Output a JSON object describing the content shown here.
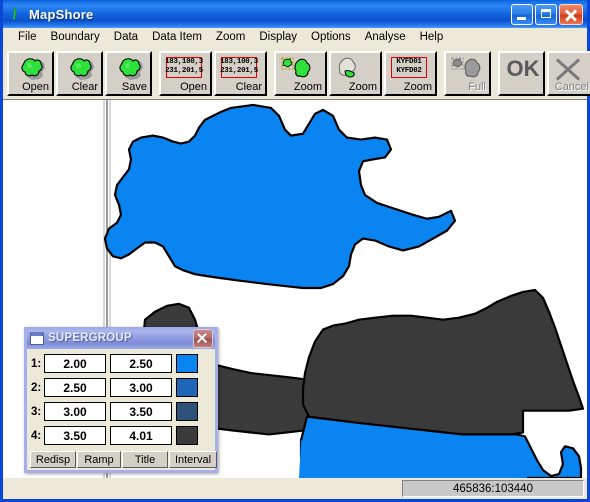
{
  "window": {
    "title": "MapShore",
    "icon": "mapshore-logo-icon",
    "caption": {
      "minimize": "minimize-icon",
      "maximize": "maximize-icon",
      "close": "close-icon"
    }
  },
  "menubar": {
    "items": [
      {
        "label": "File"
      },
      {
        "label": "Boundary"
      },
      {
        "label": "Data"
      },
      {
        "label": "Data Item"
      },
      {
        "label": "Zoom"
      },
      {
        "label": "Display"
      },
      {
        "label": "Options"
      },
      {
        "label": "Analyse"
      },
      {
        "label": "Help"
      }
    ]
  },
  "toolbar": {
    "buttons": [
      {
        "label": "Open",
        "icon": "boundary-open-icon",
        "kind": "shape",
        "disabled": false
      },
      {
        "label": "Clear",
        "icon": "boundary-clear-icon",
        "kind": "shape",
        "disabled": false
      },
      {
        "label": "Save",
        "icon": "boundary-save-icon",
        "kind": "shape",
        "disabled": false
      },
      {
        "label": "Open",
        "icon": "data-open-icon",
        "kind": "datalabel",
        "disabled": false,
        "data_line1": "183,100,3",
        "data_line2": "231,201,5"
      },
      {
        "label": "Clear",
        "icon": "data-clear-icon",
        "kind": "datalabel",
        "disabled": false,
        "data_line1": "183,100,3",
        "data_line2": "231,201,5"
      },
      {
        "label": "Zoom",
        "icon": "zoom-in-shape-icon",
        "kind": "zoomshape",
        "disabled": false
      },
      {
        "label": "Zoom",
        "icon": "zoom-out-shape-icon",
        "kind": "zoomout",
        "disabled": false
      },
      {
        "label": "Zoom",
        "icon": "zoom-dataitem-icon",
        "kind": "datalabel",
        "disabled": false,
        "data_line1": "KYFD01",
        "data_line2": "KYFD02"
      },
      {
        "label": "Full",
        "icon": "zoom-full-icon",
        "kind": "shapegrey",
        "disabled": true
      },
      {
        "label": "OK",
        "icon": "ok-icon",
        "kind": "ok",
        "disabled": false
      },
      {
        "label": "Cancel",
        "icon": "cancel-icon",
        "kind": "cancel",
        "disabled": true
      }
    ]
  },
  "map": {
    "background": "#ffffff",
    "outline_color": "#000000",
    "ruler_color": "#808080",
    "regions": [
      {
        "name": "north-region",
        "fill": "#0a84f0"
      },
      {
        "name": "central-region",
        "fill": "#3a3a3a"
      },
      {
        "name": "east-region",
        "fill": "#3a3a3a"
      },
      {
        "name": "southeast-region",
        "fill": "#0a84f0"
      }
    ]
  },
  "statusbar": {
    "coordinates": "465836:103440"
  },
  "dialog": {
    "title": "SUPERGROUP",
    "icon": "window-icon",
    "close": "close-icon",
    "rows": [
      {
        "index": "1:",
        "min": "2.00",
        "max": "2.50",
        "color": "#0a84f0"
      },
      {
        "index": "2:",
        "min": "2.50",
        "max": "3.00",
        "color": "#1f66b8"
      },
      {
        "index": "3:",
        "min": "3.00",
        "max": "3.50",
        "color": "#2c5277"
      },
      {
        "index": "4:",
        "min": "3.50",
        "max": "4.01",
        "color": "#3a3a3a"
      }
    ],
    "buttons": [
      {
        "label": "Redisp"
      },
      {
        "label": "Ramp"
      },
      {
        "label": "Title"
      },
      {
        "label": "Interval"
      }
    ]
  }
}
